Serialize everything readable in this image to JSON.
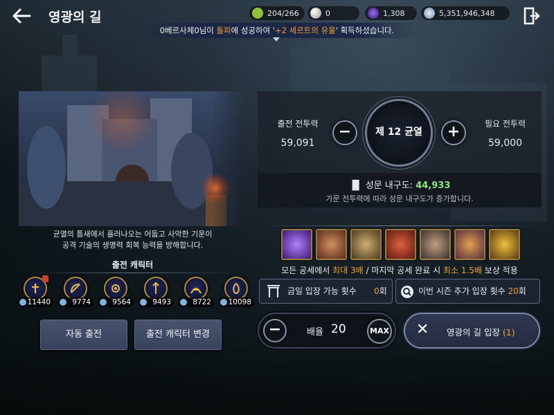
{
  "header": {
    "title": "영광의 길",
    "resources": [
      {
        "icon": "stamina-icon",
        "value": "204/266",
        "color": "#8fc23a"
      },
      {
        "icon": "pearl-icon",
        "value": "0",
        "color": "#d0d0d0"
      },
      {
        "icon": "crystal-icon",
        "value": "1,308",
        "color": "#6a3ac0"
      },
      {
        "icon": "silver-coin-icon",
        "value": "5,351,946,348",
        "color": "#a8c8e8"
      }
    ]
  },
  "notice": {
    "prefix": "0베르사체0님이 ",
    "action": "돌파",
    "mid": "에 성공하여 '",
    "item": "+2 세르트의 유물",
    "suffix": "' 획득하셨습니다."
  },
  "left": {
    "description": [
      "균열의 틈새에서 흘러나오는 어둡고 사악한 기운이",
      "공격 기술의 생명력 회복 능력을 방해합니다."
    ],
    "section_title": "출전 캐릭터",
    "characters": [
      {
        "icon": "warrior-class-icon",
        "power": "11440",
        "locked": true
      },
      {
        "icon": "archer-class-icon",
        "power": "9774"
      },
      {
        "icon": "sorceress-class-icon",
        "power": "9564"
      },
      {
        "icon": "lancer-class-icon",
        "power": "9493"
      },
      {
        "icon": "ranger-class-icon",
        "power": "8722"
      },
      {
        "icon": "witch-class-icon",
        "power": "10098"
      }
    ],
    "auto_button": "자동 출전",
    "change_button": "출전 캐릭터 변경"
  },
  "right": {
    "my_power_label": "출전 전투력",
    "my_power": "59,091",
    "rift_label": "제 12 균열",
    "req_power_label": "필요 전투력",
    "req_power": "59,000",
    "wall_label": "성문 내구도: ",
    "wall_value": "44,933",
    "wall_sub": "가문 전투력에 따라 성문 내구도가 증가합니다.",
    "rewards": [
      "purple-crystal-icon",
      "bronze-emblem-icon",
      "compass-icon",
      "red-chest-icon",
      "silver-chest-icon",
      "gem-pouch-icon",
      "gold-trophy-icon"
    ],
    "bonus": {
      "a": "모든 공세에서 ",
      "b": "최대 3배",
      "c": " / 마지막 공세 완료 시 ",
      "d": "최소 1.5배",
      "e": " 보상 적용"
    },
    "today_label": "금일 입장 가능 횟수",
    "today_value": "0",
    "today_unit": "회",
    "season_label": "이번 시즌 추가 입장 횟수",
    "season_value": "20",
    "season_unit": "회",
    "multiplier_label": "배율",
    "multiplier_value": "20",
    "max_label": "MAX",
    "enter_label": "영광의 길 입장 ",
    "enter_count": "(1)"
  }
}
